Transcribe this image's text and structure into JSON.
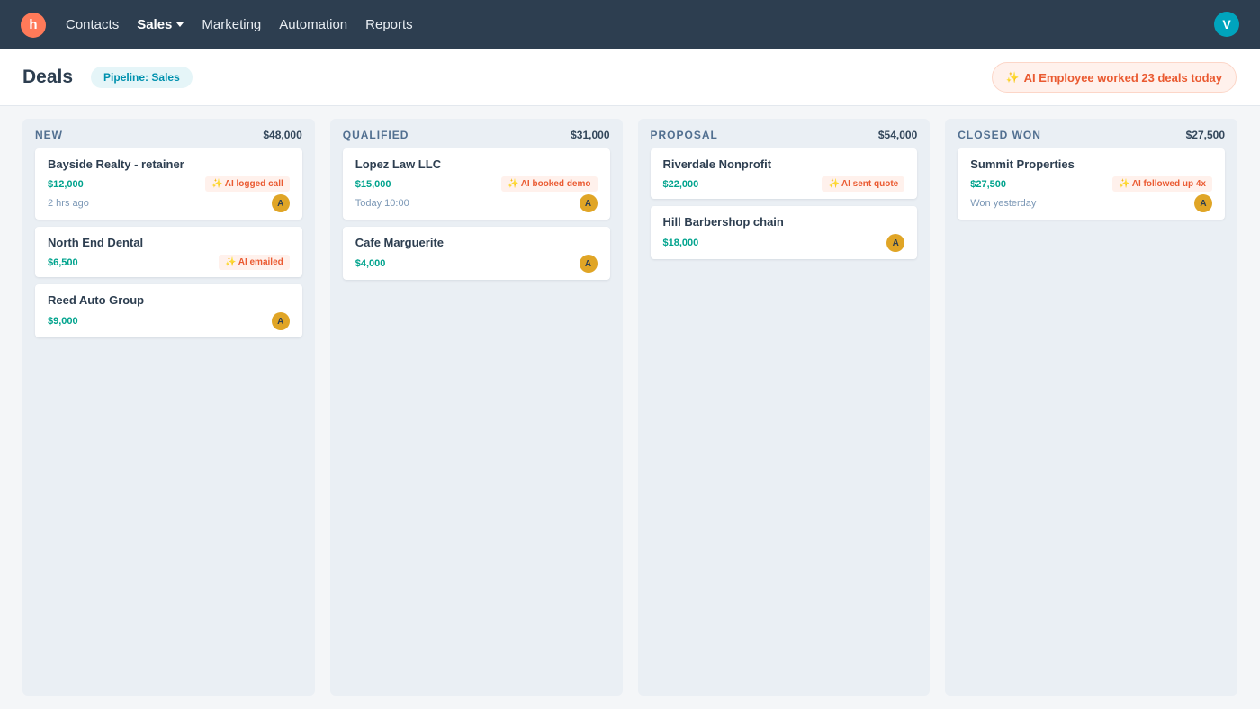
{
  "nav": {
    "logo": "h",
    "items": [
      "Contacts",
      "Sales",
      "Marketing",
      "Automation",
      "Reports"
    ],
    "user_initial": "V"
  },
  "header": {
    "title": "Deals",
    "pipeline": "Pipeline: Sales",
    "ai_summary": "AI Employee worked 23 deals today",
    "sparkle": "✨"
  },
  "columns": [
    {
      "title": "NEW",
      "total": "$48,000",
      "cards": [
        {
          "name": "Bayside Realty - retainer",
          "amount": "$12,000",
          "ai_tag": "AI logged call",
          "time": "2 hrs ago",
          "owner": "A"
        },
        {
          "name": "North End Dental",
          "amount": "$6,500",
          "ai_tag": "AI emailed"
        },
        {
          "name": "Reed Auto Group",
          "amount": "$9,000",
          "owner": "A"
        }
      ]
    },
    {
      "title": "QUALIFIED",
      "total": "$31,000",
      "cards": [
        {
          "name": "Lopez Law LLC",
          "amount": "$15,000",
          "ai_tag": "AI booked demo",
          "time": "Today 10:00",
          "owner": "A"
        },
        {
          "name": "Cafe Marguerite",
          "amount": "$4,000",
          "owner": "A"
        }
      ]
    },
    {
      "title": "PROPOSAL",
      "total": "$54,000",
      "cards": [
        {
          "name": "Riverdale Nonprofit",
          "amount": "$22,000",
          "ai_tag": "AI sent quote"
        },
        {
          "name": "Hill Barbershop chain",
          "amount": "$18,000",
          "owner": "A"
        }
      ]
    },
    {
      "title": "CLOSED WON",
      "total": "$27,500",
      "cards": [
        {
          "name": "Summit Properties",
          "amount": "$27,500",
          "ai_tag": "AI followed up 4x",
          "time": "Won yesterday",
          "owner": "A"
        }
      ]
    }
  ]
}
